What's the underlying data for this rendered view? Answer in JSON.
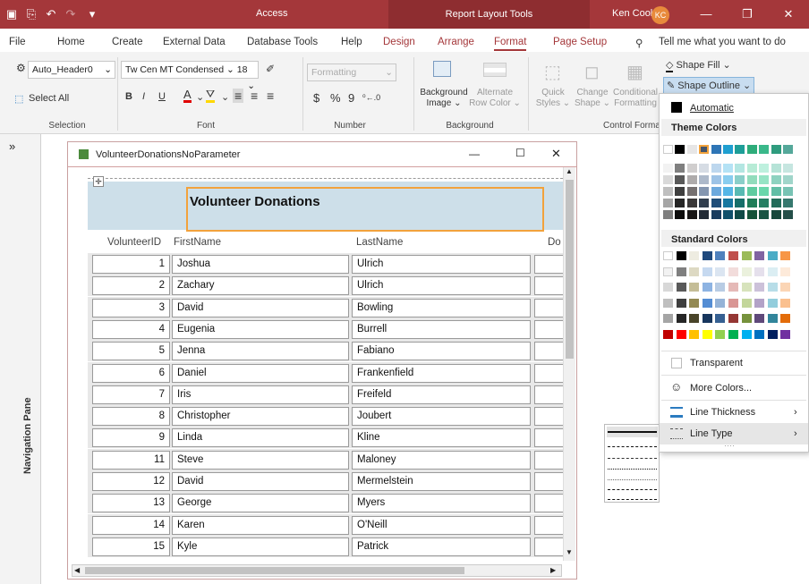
{
  "title_bar": {
    "app": "Access",
    "context": "Report Layout Tools",
    "user": "Ken Cook",
    "initials": "KC"
  },
  "menu": {
    "tabs": [
      "File",
      "Home",
      "Create",
      "External Data",
      "Database Tools",
      "Help",
      "Design",
      "Arrange",
      "Format",
      "Page Setup"
    ],
    "tell": "Tell me what you want to do"
  },
  "ribbon": {
    "selection": {
      "object": "Auto_Header0",
      "select_all": "Select All",
      "label": "Selection"
    },
    "font": {
      "name": "Tw Cen MT Condensed",
      "size": "18",
      "bold": "B",
      "italic": "I",
      "underline": "U",
      "label": "Font"
    },
    "number": {
      "format": "Formatting",
      "currency": "$",
      "percent": "%",
      "comma": "9",
      "label": "Number"
    },
    "background": {
      "bg_image": "Background",
      "bg_image2": "Image",
      "alt_row": "Alternate",
      "alt_row2": "Row Color",
      "label": "Background"
    },
    "control": {
      "quick": "Quick",
      "quick2": "Styles",
      "change": "Change",
      "change2": "Shape",
      "cond": "Conditional",
      "cond2": "Formatting",
      "fill": "Shape Fill",
      "outline": "Shape Outline",
      "label": "Control Formatting"
    }
  },
  "nav_pane": {
    "label": "Navigation Pane",
    "collapse": "»"
  },
  "report_window": {
    "title": "VolunteerDonationsNoParameter",
    "report_title": "Volunteer Donations",
    "columns": [
      "VolunteerID",
      "FirstName",
      "LastName",
      "Do"
    ],
    "rows": [
      {
        "id": "1",
        "first": "Joshua",
        "last": "Ulrich"
      },
      {
        "id": "2",
        "first": "Zachary",
        "last": "Ulrich"
      },
      {
        "id": "3",
        "first": "David",
        "last": "Bowling"
      },
      {
        "id": "4",
        "first": "Eugenia",
        "last": "Burrell"
      },
      {
        "id": "5",
        "first": "Jenna",
        "last": "Fabiano"
      },
      {
        "id": "6",
        "first": "Daniel",
        "last": "Frankenfield"
      },
      {
        "id": "7",
        "first": "Iris",
        "last": "Freifeld"
      },
      {
        "id": "8",
        "first": "Christopher",
        "last": "Joubert"
      },
      {
        "id": "9",
        "first": "Linda",
        "last": "Kline"
      },
      {
        "id": "11",
        "first": "Steve",
        "last": "Maloney"
      },
      {
        "id": "12",
        "first": "David",
        "last": "Mermelstein"
      },
      {
        "id": "13",
        "first": "George",
        "last": "Myers"
      },
      {
        "id": "14",
        "first": "Karen",
        "last": "O'Neill"
      },
      {
        "id": "15",
        "first": "Kyle",
        "last": "Patrick"
      }
    ]
  },
  "dropdown": {
    "automatic": "Automatic",
    "theme_colors": "Theme Colors",
    "standard_colors": "Standard Colors",
    "transparent": "Transparent",
    "more_colors": "More Colors...",
    "line_thickness": "Line Thickness",
    "line_type": "Line Type",
    "theme_top": [
      "#ffffff",
      "#000000",
      "#e7e6e6",
      "#44546a",
      "#2e75b6",
      "#1f9fd0",
      "#1e9e98",
      "#2eac7a",
      "#3ab88a",
      "#2f9c7e",
      "#55a89a"
    ],
    "theme_shades": [
      [
        "#f2f2f2",
        "#7f7f7f",
        "#d0cece",
        "#d6dce4",
        "#bdd7ee",
        "#b4e2f5",
        "#b3e6e2",
        "#b7ebd6",
        "#bef0de",
        "#b6e3d7",
        "#c6e6e0"
      ],
      [
        "#d9d9d9",
        "#595959",
        "#aeabab",
        "#adb9ca",
        "#9dc3e6",
        "#89cdef",
        "#8acfc9",
        "#92dcbc",
        "#97e4c5",
        "#8ed2c0",
        "#a0d5ca"
      ],
      [
        "#bfbfbf",
        "#3f3f3f",
        "#757070",
        "#8496b0",
        "#6ca9dd",
        "#56b6e6",
        "#59bab3",
        "#5fcb9f",
        "#6ad7ab",
        "#62bea6",
        "#78c3b4"
      ],
      [
        "#a6a6a6",
        "#262626",
        "#3a3838",
        "#323f4f",
        "#1f4e79",
        "#1677a0",
        "#166f6a",
        "#1f7d58",
        "#267f63",
        "#236c5a",
        "#36786e"
      ],
      [
        "#7f7f7f",
        "#0d0d0d",
        "#171616",
        "#222a35",
        "#1a3c5e",
        "#0f4f6b",
        "#0f4a47",
        "#145339",
        "#195443",
        "#17483c",
        "#244f49"
      ]
    ],
    "standard": [
      [
        "#ffffff",
        "#000000",
        "#eeece1",
        "#1f497d",
        "#4f81bd",
        "#c0504d",
        "#9bbb59",
        "#8064a2",
        "#4bacc6",
        "#f79646"
      ],
      [
        "#f2f2f2",
        "#7f7f7f",
        "#ddd9c3",
        "#c6d9f0",
        "#dbe5f1",
        "#f2dcdb",
        "#ebf1dd",
        "#e5e0ec",
        "#dbeef3",
        "#fdeada"
      ],
      [
        "#d8d8d8",
        "#595959",
        "#c4bd97",
        "#8db3e2",
        "#b8cce4",
        "#e5b9b7",
        "#d7e3bc",
        "#ccc1d9",
        "#b7dde8",
        "#fbd5b5"
      ],
      [
        "#bfbfbf",
        "#3f3f3f",
        "#938953",
        "#548dd4",
        "#95b3d7",
        "#d99694",
        "#c3d69b",
        "#b2a2c7",
        "#92cddc",
        "#fac08f"
      ],
      [
        "#a5a5a5",
        "#262626",
        "#494429",
        "#17365d",
        "#366092",
        "#953734",
        "#76923c",
        "#5f497a",
        "#31859b",
        "#e36c09"
      ],
      [
        "#c00000",
        "#ff0000",
        "#ffc000",
        "#ffff00",
        "#92d050",
        "#00b050",
        "#00b0f0",
        "#0070c0",
        "#002060",
        "#7030a0"
      ]
    ]
  }
}
